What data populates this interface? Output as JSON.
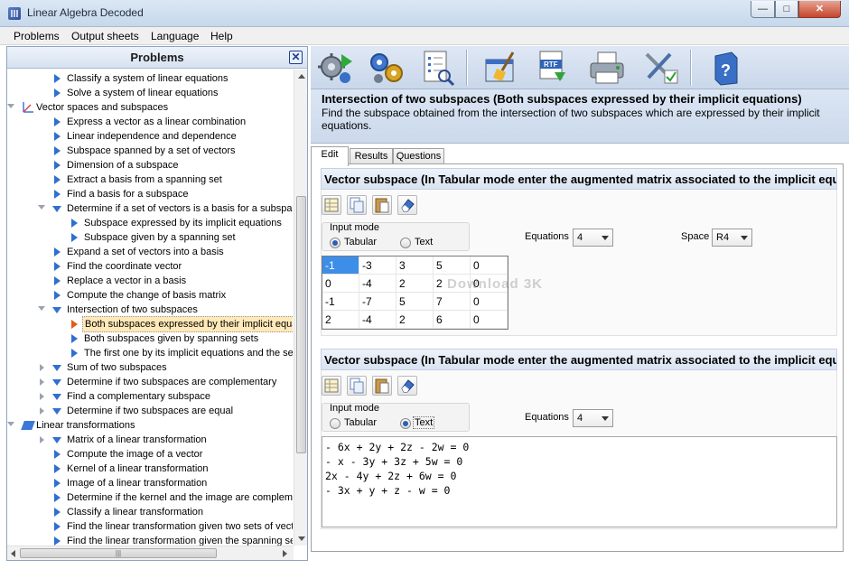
{
  "window": {
    "title": "Linear Algebra Decoded"
  },
  "menu": [
    "Problems",
    "Output sheets",
    "Language",
    "Help"
  ],
  "left_panel": {
    "title": "Problems",
    "tree": [
      {
        "label": "Classify a system of linear equations",
        "level": 2,
        "kind": "leaf"
      },
      {
        "label": "Solve a system of linear equations",
        "level": 2,
        "kind": "leaf"
      },
      {
        "label": "Vector spaces and subspaces",
        "level": 1,
        "kind": "category-vec",
        "expanded": true
      },
      {
        "label": "Express a vector as a linear combination",
        "level": 2,
        "kind": "leaf"
      },
      {
        "label": "Linear independence and dependence",
        "level": 2,
        "kind": "leaf"
      },
      {
        "label": "Subspace spanned by a set of vectors",
        "level": 2,
        "kind": "leaf"
      },
      {
        "label": "Dimension of a subspace",
        "level": 2,
        "kind": "leaf"
      },
      {
        "label": "Extract a basis from a spanning set",
        "level": 2,
        "kind": "leaf"
      },
      {
        "label": "Find a basis for a subspace",
        "level": 2,
        "kind": "leaf"
      },
      {
        "label": "Determine if a set of vectors is a basis for a subspac",
        "level": 2,
        "kind": "group",
        "expanded": true
      },
      {
        "label": "Subspace expressed by its implicit equations",
        "level": 3,
        "kind": "leaf"
      },
      {
        "label": "Subspace given by a spanning set",
        "level": 3,
        "kind": "leaf"
      },
      {
        "label": "Expand a set of vectors into a basis",
        "level": 2,
        "kind": "leaf"
      },
      {
        "label": "Find the coordinate vector",
        "level": 2,
        "kind": "leaf"
      },
      {
        "label": "Replace a vector in a basis",
        "level": 2,
        "kind": "leaf"
      },
      {
        "label": "Compute the change of basis matrix",
        "level": 2,
        "kind": "leaf"
      },
      {
        "label": "Intersection of two subspaces",
        "level": 2,
        "kind": "group",
        "expanded": true
      },
      {
        "label": "Both subspaces expressed by their implicit equa",
        "level": 3,
        "kind": "leaf",
        "selected": true
      },
      {
        "label": "Both subspaces given by spanning sets",
        "level": 3,
        "kind": "leaf"
      },
      {
        "label": "The first one by its implicit equations and the sec",
        "level": 3,
        "kind": "leaf"
      },
      {
        "label": "Sum of two subspaces",
        "level": 2,
        "kind": "group",
        "expanded": false
      },
      {
        "label": "Determine if two subspaces are complementary",
        "level": 2,
        "kind": "group",
        "expanded": false
      },
      {
        "label": "Find a complementary subspace",
        "level": 2,
        "kind": "group",
        "expanded": false
      },
      {
        "label": "Determine if two subspaces are equal",
        "level": 2,
        "kind": "group",
        "expanded": false
      },
      {
        "label": "Linear transformations",
        "level": 1,
        "kind": "category-lin",
        "expanded": true
      },
      {
        "label": "Matrix of a linear transformation",
        "level": 2,
        "kind": "group",
        "expanded": false
      },
      {
        "label": "Compute the image of a vector",
        "level": 2,
        "kind": "leaf"
      },
      {
        "label": "Kernel of a linear transformation",
        "level": 2,
        "kind": "leaf"
      },
      {
        "label": "Image of a linear transformation",
        "level": 2,
        "kind": "leaf"
      },
      {
        "label": "Determine if the kernel and the image are compleme",
        "level": 2,
        "kind": "leaf"
      },
      {
        "label": "Classify a linear transformation",
        "level": 2,
        "kind": "leaf"
      },
      {
        "label": "Find the linear transformation given two sets of vect",
        "level": 2,
        "kind": "leaf"
      },
      {
        "label": "Find the linear transformation given the spanning se",
        "level": 2,
        "kind": "leaf"
      }
    ]
  },
  "toolbar": {
    "buttons": [
      "settings-run-icon",
      "gears-icon",
      "report-icon",
      "clear-broom-icon",
      "rtf-export-icon",
      "printer-icon",
      "tools-options-icon",
      "help-book-icon"
    ]
  },
  "problem": {
    "title": "Intersection of two subspaces (Both subspaces expressed by their implicit equations)",
    "description": "Find the subspace obtained from the intersection of two subspaces which are expressed by their implicit equations."
  },
  "tabs": [
    "Edit",
    "Results",
    "Questions"
  ],
  "subspace1": {
    "heading": "Vector subspace (In Tabular mode enter the augmented matrix associated to the implicit equations)",
    "input_mode_label": "Input mode",
    "mode_tabular": "Tabular",
    "mode_text": "Text",
    "selected_mode": "Tabular",
    "equations_label": "Equations",
    "equations_value": "4",
    "space_label": "Space",
    "space_value": "R4",
    "matrix": [
      [
        "-1",
        "-3",
        "3",
        "5",
        "0"
      ],
      [
        "0",
        "-4",
        "2",
        "2",
        "0"
      ],
      [
        "-1",
        "-7",
        "5",
        "7",
        "0"
      ],
      [
        "2",
        "-4",
        "2",
        "6",
        "0"
      ]
    ]
  },
  "subspace2": {
    "heading": "Vector subspace (In Tabular mode enter the augmented matrix associated to the implicit equations)",
    "input_mode_label": "Input mode",
    "mode_tabular": "Tabular",
    "mode_text": "Text",
    "selected_mode": "Text",
    "equations_label": "Equations",
    "equations_value": "4",
    "equations": [
      "- 6x + 2y + 2z - 2w = 0",
      "- x - 3y + 3z + 5w = 0",
      "2x - 4y + 2z + 6w = 0",
      "- 3x + y + z - w = 0"
    ]
  },
  "watermark": "Download 3K"
}
